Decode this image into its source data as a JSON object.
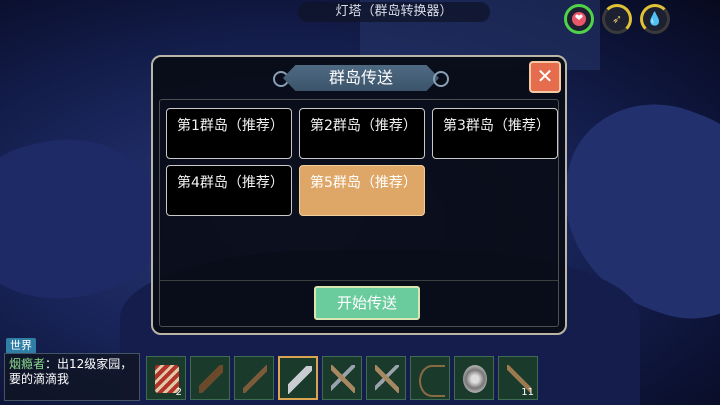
{
  "top_title": "灯塔（群岛转换器）",
  "status": {
    "heart_icon": "heart-icon",
    "heart_glyph": "❤",
    "food_glyph": "➶",
    "water_glyph": "💧"
  },
  "dialog": {
    "title": "群岛传送",
    "close_glyph": "✕",
    "islands": [
      {
        "label": "第1群岛（推荐）",
        "selected": false
      },
      {
        "label": "第2群岛（推荐）",
        "selected": false
      },
      {
        "label": "第3群岛（推荐）",
        "selected": false
      },
      {
        "label": "第4群岛（推荐）",
        "selected": false
      },
      {
        "label": "第5群岛（推荐）",
        "selected": true
      }
    ],
    "start_button": "开始传送"
  },
  "chat": {
    "tab_label": "世界",
    "sender": "烟瘾者",
    "message": "：出12级家园，要的滴滴我"
  },
  "hotbar": {
    "slots": [
      {
        "icon": "cloth-icon",
        "count": "2"
      },
      {
        "icon": "wooden-club-icon",
        "count": ""
      },
      {
        "icon": "stone-axe-icon",
        "count": ""
      },
      {
        "icon": "blade-icon",
        "count": ""
      },
      {
        "icon": "battle-axe-icon",
        "count": ""
      },
      {
        "icon": "pickaxe-icon",
        "count": ""
      },
      {
        "icon": "bow-icon",
        "count": ""
      },
      {
        "icon": "disc-icon",
        "count": ""
      },
      {
        "icon": "hook-icon",
        "count": "11"
      }
    ]
  }
}
